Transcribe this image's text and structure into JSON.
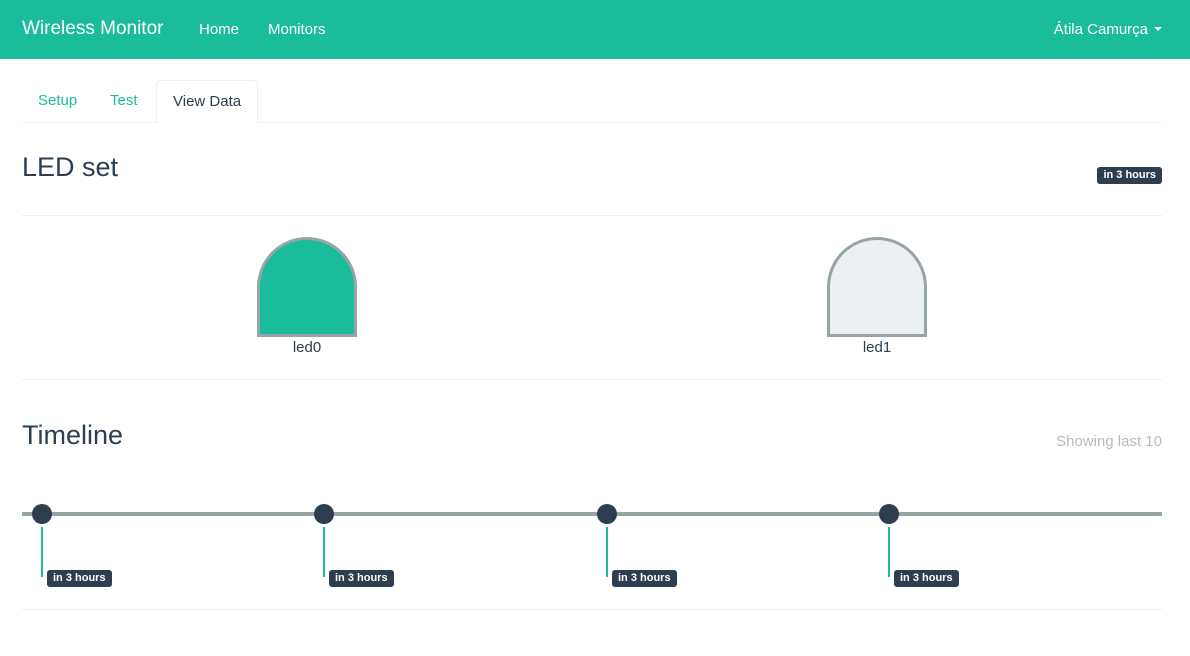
{
  "navbar": {
    "brand": "Wireless Monitor",
    "links": [
      "Home",
      "Monitors"
    ],
    "user": "Átila Camurça"
  },
  "tabs": [
    "Setup",
    "Test",
    "View Data"
  ],
  "active_tab": "View Data",
  "led_section": {
    "title": "LED set",
    "badge": "in 3 hours",
    "leds": [
      {
        "label": "led0",
        "state": "on",
        "color": "#1abc9c"
      },
      {
        "label": "led1",
        "state": "off",
        "color": "#ecf0f1"
      }
    ]
  },
  "timeline": {
    "title": "Timeline",
    "info": "Showing last 10",
    "events": [
      {
        "time": "in 3 hours"
      },
      {
        "time": "in 3 hours"
      },
      {
        "time": "in 3 hours"
      },
      {
        "time": "in 3 hours"
      }
    ]
  },
  "colors": {
    "accent": "#1abc9c",
    "dark": "#2c3e50",
    "muted": "#95a5a6",
    "light": "#ecf0f1"
  }
}
